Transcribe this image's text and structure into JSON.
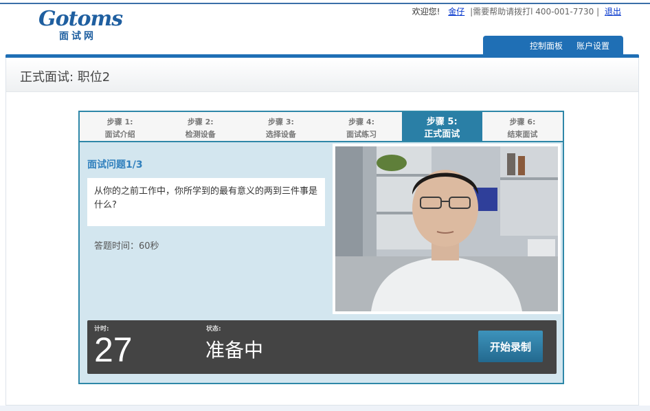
{
  "brand": {
    "logo_text": "Gotoms",
    "logo_sub": "面试网"
  },
  "topbar": {
    "welcome": "欢迎您!",
    "user": "金仔",
    "help": "|需要帮助请拨打l 400-001-7730  |",
    "logout": "退出"
  },
  "nav": {
    "dashboard": "控制面板",
    "account": "账户设置"
  },
  "page": {
    "title": "正式面试: 职位2"
  },
  "steps": [
    {
      "num": "步骤 1:",
      "name": "面试介绍"
    },
    {
      "num": "步骤 2:",
      "name": "检测设备"
    },
    {
      "num": "步骤 3:",
      "name": "选择设备"
    },
    {
      "num": "步骤 4:",
      "name": "面试练习"
    },
    {
      "num": "步骤 5:",
      "name": "正式面试"
    },
    {
      "num": "步骤 6:",
      "name": "结束面试"
    }
  ],
  "question": {
    "title": "面试问题1/3",
    "text": "从你的之前工作中，你所学到的最有意义的两到三件事是什么?",
    "time": "答题时间：60秒"
  },
  "control": {
    "timer_label": "计时:",
    "timer": "27",
    "status_label": "状态:",
    "status": "准备中",
    "record_button": "开始录制"
  },
  "colors": {
    "accent": "#2a7fa6",
    "nav": "#1f6fb5",
    "panel_bg": "#d3e6ef"
  }
}
